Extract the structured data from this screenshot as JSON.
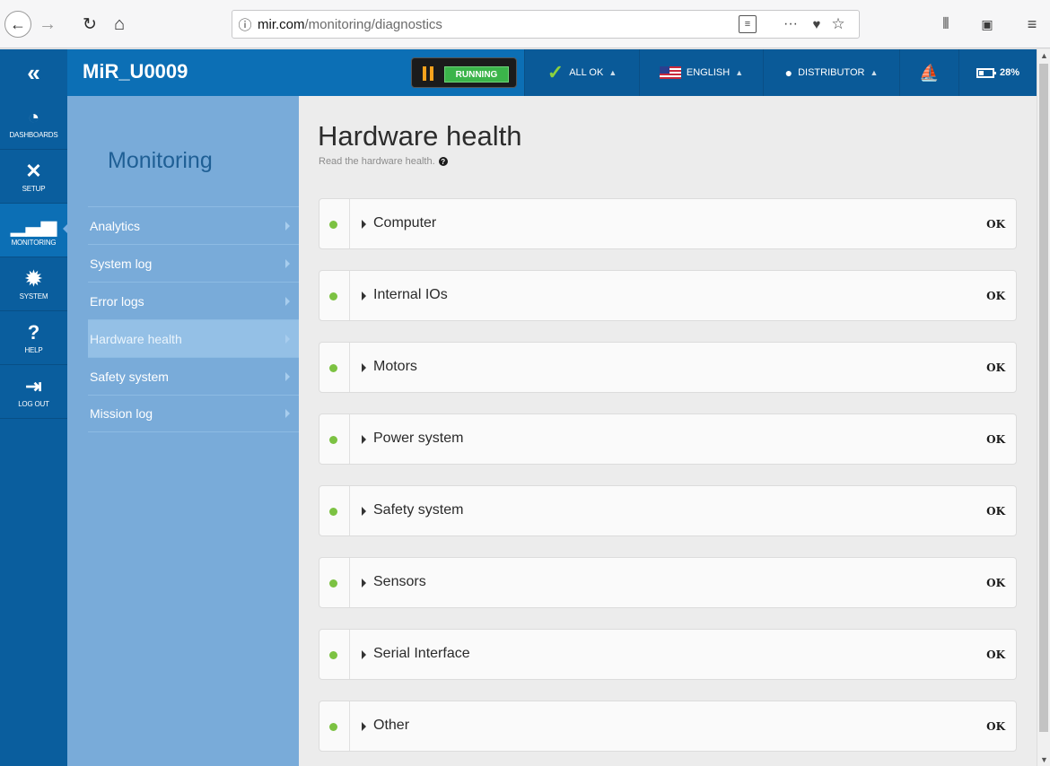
{
  "browser": {
    "url_host": "mir.com",
    "url_path": "/monitoring/diagnostics",
    "icons": [
      "back-icon",
      "forward-icon",
      "reload-icon",
      "home-icon",
      "info-icon",
      "reader-icon",
      "more-icon",
      "pocket-icon",
      "bookmark-star-icon",
      "library-icon",
      "sidebar-icon",
      "menu-icon"
    ]
  },
  "header": {
    "robot_name": "MiR_U0009",
    "run_state": "RUNNING",
    "status": "ALL OK",
    "language": "ENGLISH",
    "user": "DISTRIBUTOR",
    "battery": "28%",
    "colors": {
      "bar": "#0c6fb5",
      "running": "#3bb44a",
      "pause": "#f6a21d",
      "ok": "#8bd13f"
    }
  },
  "nav": {
    "items": [
      {
        "label": "DASHBOARDS",
        "icon": "speedometer-icon"
      },
      {
        "label": "SETUP",
        "icon": "tools-icon"
      },
      {
        "label": "MONITORING",
        "icon": "chart-icon"
      },
      {
        "label": "SYSTEM",
        "icon": "gear-icon"
      },
      {
        "label": "HELP",
        "icon": "help-icon"
      },
      {
        "label": "LOG OUT",
        "icon": "logout-icon"
      }
    ]
  },
  "submenu": {
    "title": "Monitoring",
    "items": [
      {
        "label": "Analytics"
      },
      {
        "label": "System log"
      },
      {
        "label": "Error logs"
      },
      {
        "label": "Hardware health",
        "active": true
      },
      {
        "label": "Safety system"
      },
      {
        "label": "Mission log"
      }
    ]
  },
  "main": {
    "title": "Hardware health",
    "subtitle": "Read the hardware health.",
    "rows": [
      {
        "label": "Computer",
        "status": "OK"
      },
      {
        "label": "Internal IOs",
        "status": "OK"
      },
      {
        "label": "Motors",
        "status": "OK"
      },
      {
        "label": "Power system",
        "status": "OK"
      },
      {
        "label": "Safety system",
        "status": "OK"
      },
      {
        "label": "Sensors",
        "status": "OK"
      },
      {
        "label": "Serial Interface",
        "status": "OK"
      },
      {
        "label": "Other",
        "status": "OK"
      }
    ]
  }
}
